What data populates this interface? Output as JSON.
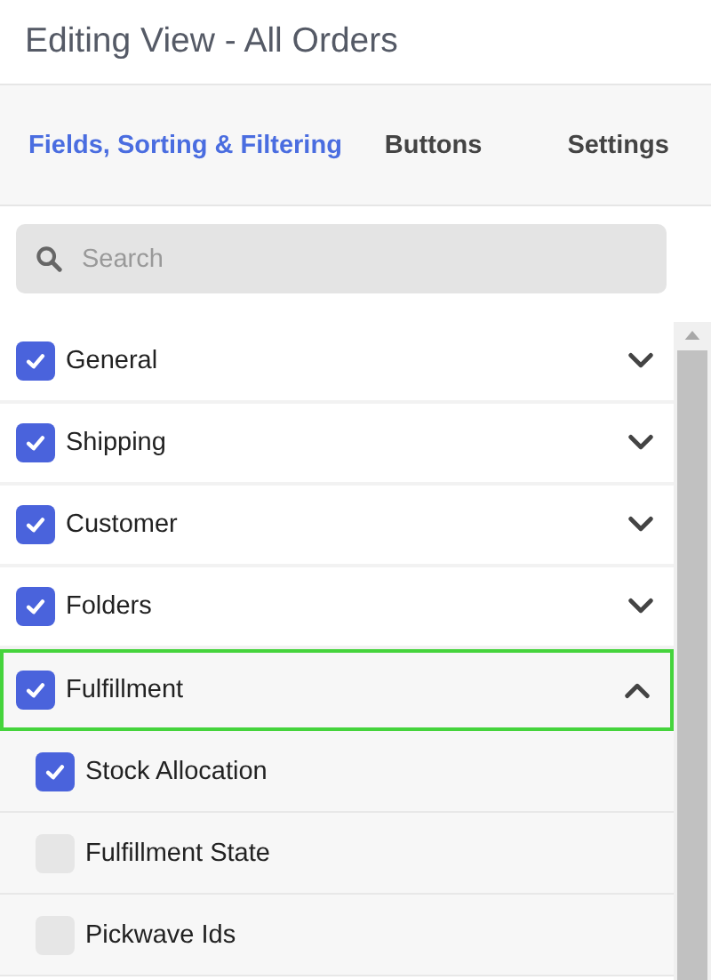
{
  "title": "Editing View - All Orders",
  "tabs": [
    {
      "label": "Fields, Sorting & Filtering",
      "selected": true
    },
    {
      "label": "Buttons",
      "selected": false
    },
    {
      "label": "Settings",
      "selected": false
    }
  ],
  "search": {
    "placeholder": "Search"
  },
  "groups": [
    {
      "label": "General",
      "checked": true,
      "expanded": false,
      "selected": false
    },
    {
      "label": "Shipping",
      "checked": true,
      "expanded": false,
      "selected": false
    },
    {
      "label": "Customer",
      "checked": true,
      "expanded": false,
      "selected": false
    },
    {
      "label": "Folders",
      "checked": true,
      "expanded": false,
      "selected": false
    },
    {
      "label": "Fulfillment",
      "checked": true,
      "expanded": true,
      "selected": true,
      "children": [
        {
          "label": "Stock Allocation",
          "checked": true
        },
        {
          "label": "Fulfillment State",
          "checked": false
        },
        {
          "label": "Pickwave Ids",
          "checked": false
        }
      ]
    }
  ]
}
